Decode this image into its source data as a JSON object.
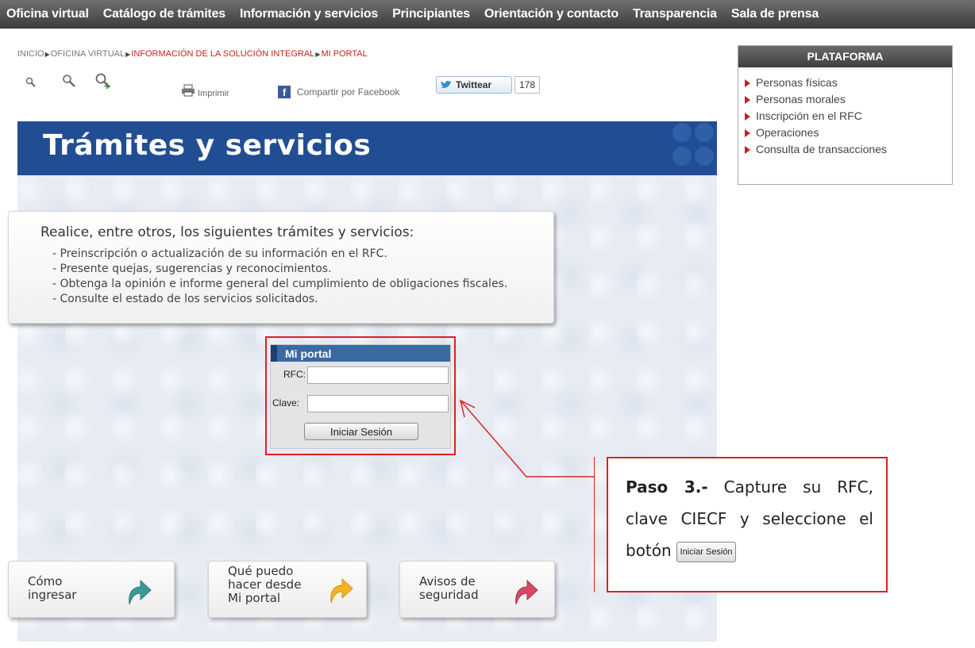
{
  "nav": {
    "items": [
      "Oficina virtual",
      "Catálogo de trámites",
      "Información y servicios",
      "Principiantes",
      "Orientación y contacto",
      "Transparencia",
      "Sala de prensa"
    ]
  },
  "breadcrumb": {
    "inicio": "INICIO",
    "oficina": "OFICINA VIRTUAL",
    "solucion": "INFORMACIÓN DE LA SOLUCIÓN INTEGRAL",
    "portal": "MI PORTAL"
  },
  "tools": {
    "print_label": "Imprimir",
    "facebook_label": "Compartir por Facebook",
    "twitter_label": "Twittear",
    "twitter_count": "178"
  },
  "banner": {
    "title": "Trámites y servicios"
  },
  "info": {
    "heading": "Realice, entre otros, los siguientes trámites y servicios:",
    "items": [
      "- Preinscripción o actualización de su información en el RFC.",
      "- Presente quejas, sugerencias y reconocimientos.",
      "- Obtenga la opinión e informe general del cumplimiento de obligaciones fiscales.",
      "- Consulte el estado de los servicios solicitados."
    ]
  },
  "portal": {
    "title": "Mi portal",
    "rfc_label": "RFC:",
    "rfc_value": "",
    "clave_label": "Clave:",
    "clave_value": "",
    "login_button": "Iniciar Sesión"
  },
  "bottom": {
    "como": [
      "Cómo",
      "ingresar"
    ],
    "que": [
      "Qué puedo",
      "hacer desde",
      "Mi portal"
    ],
    "avisos": [
      "Avisos de",
      "seguridad"
    ]
  },
  "sidebar": {
    "title": "PLATAFORMA",
    "items": [
      "Personas físicas",
      "Personas morales",
      "Inscripción en el RFC",
      "Operaciones",
      "Consulta de transacciones"
    ]
  },
  "callout": {
    "step": "Paso 3.-",
    "text": "Capture su RFC, clave CIECF y seleccione el botón",
    "button": "Iniciar Sesión"
  },
  "colors": {
    "banner": "#214e93",
    "accent_red": "#c8211b",
    "callout_border": "#e02020"
  }
}
